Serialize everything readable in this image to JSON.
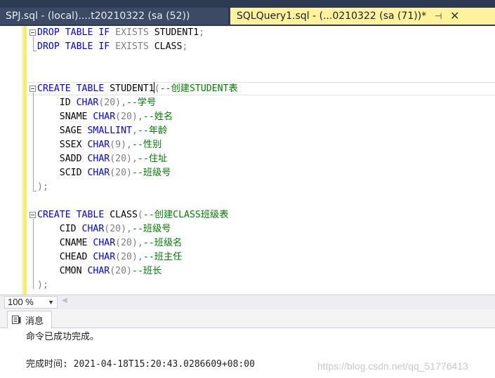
{
  "tabs": [
    {
      "label": "SPJ.sql - (local)....t20210322 (sa (52))",
      "active": false
    },
    {
      "label": "SQLQuery1.sql - (...0210322 (sa (71))*",
      "active": true
    }
  ],
  "tab_controls": {
    "pin_glyph": "⊣",
    "close_glyph": "✕"
  },
  "editor": {
    "lines": [
      {
        "row": 0,
        "fold": true,
        "segments": [
          [
            "kw",
            "DROP TABLE IF "
          ],
          [
            "gray",
            "EXISTS "
          ],
          [
            "t",
            "STUDENT1"
          ],
          [
            "gray",
            ";"
          ]
        ]
      },
      {
        "row": 1,
        "segments": [
          [
            "kw",
            "DROP TABLE IF "
          ],
          [
            "gray",
            "EXISTS "
          ],
          [
            "t",
            "CLASS"
          ],
          [
            "gray",
            ";"
          ]
        ]
      },
      {
        "row": 4,
        "fold": true,
        "segments": [
          [
            "kw",
            "CREATE TABLE "
          ],
          [
            "t",
            "STUDENT1"
          ],
          [
            "caret",
            ""
          ],
          [
            "gray",
            "("
          ],
          [
            "cm",
            "--创建STUDENT表"
          ]
        ]
      },
      {
        "row": 5,
        "segments": [
          [
            "t",
            "    ID "
          ],
          [
            "kw",
            "CHAR"
          ],
          [
            "gray",
            "(20),"
          ],
          [
            "cm",
            "--学号"
          ]
        ]
      },
      {
        "row": 6,
        "segments": [
          [
            "t",
            "    SNAME "
          ],
          [
            "kw",
            "CHAR"
          ],
          [
            "gray",
            "(20),"
          ],
          [
            "cm",
            "--姓名"
          ]
        ]
      },
      {
        "row": 7,
        "segments": [
          [
            "t",
            "    SAGE "
          ],
          [
            "kw",
            "SMALLINT"
          ],
          [
            "gray",
            ","
          ],
          [
            "cm",
            "--年龄"
          ]
        ]
      },
      {
        "row": 8,
        "segments": [
          [
            "t",
            "    SSEX "
          ],
          [
            "kw",
            "CHAR"
          ],
          [
            "gray",
            "(9),"
          ],
          [
            "cm",
            "--性别"
          ]
        ]
      },
      {
        "row": 9,
        "segments": [
          [
            "t",
            "    SADD "
          ],
          [
            "kw",
            "CHAR"
          ],
          [
            "gray",
            "(20),"
          ],
          [
            "cm",
            "--住址"
          ]
        ]
      },
      {
        "row": 10,
        "segments": [
          [
            "t",
            "    SCID "
          ],
          [
            "kw",
            "CHAR"
          ],
          [
            "gray",
            "(20)"
          ],
          [
            "cm",
            "--班级号"
          ]
        ]
      },
      {
        "row": 11,
        "segments": [
          [
            "gray",
            ");"
          ]
        ]
      },
      {
        "row": 13,
        "fold": true,
        "segments": [
          [
            "kw",
            "CREATE TABLE "
          ],
          [
            "t",
            "CLASS"
          ],
          [
            "gray",
            "("
          ],
          [
            "cm",
            "--创建CLASS班级表"
          ]
        ]
      },
      {
        "row": 14,
        "segments": [
          [
            "t",
            "    CID "
          ],
          [
            "kw",
            "CHAR"
          ],
          [
            "gray",
            "(20),"
          ],
          [
            "cm",
            "--班级号"
          ]
        ]
      },
      {
        "row": 15,
        "segments": [
          [
            "t",
            "    CNAME "
          ],
          [
            "kw",
            "CHAR"
          ],
          [
            "gray",
            "(20),"
          ],
          [
            "cm",
            "--班级名"
          ]
        ]
      },
      {
        "row": 16,
        "segments": [
          [
            "t",
            "    CHEAD "
          ],
          [
            "kw",
            "CHAR"
          ],
          [
            "gray",
            "(20),"
          ],
          [
            "cm",
            "--班主任"
          ]
        ]
      },
      {
        "row": 17,
        "segments": [
          [
            "t",
            "    CMON "
          ],
          [
            "kw",
            "CHAR"
          ],
          [
            "gray",
            "(20)"
          ],
          [
            "cm",
            "--班长"
          ]
        ]
      },
      {
        "row": 18,
        "segments": [
          [
            "gray",
            ");"
          ]
        ]
      }
    ],
    "current_row": 4
  },
  "zoom": {
    "value": "100 %",
    "arrow": "▼",
    "scroll_left": "◀"
  },
  "results": {
    "tab_label": "消息",
    "message": "命令已成功完成。",
    "completion_time": "完成时间: 2021-04-18T15:20:43.0286609+08:00",
    "watermark": "https://blog.csdn.net/qq_51776413"
  },
  "colors": {
    "keyword": "#0000ff",
    "operator": "#808080",
    "comment": "#008000",
    "tab_active_bg": "#fff29d",
    "tab_strip_bg": "#2d3a52",
    "change_bar": "#fbed61"
  }
}
